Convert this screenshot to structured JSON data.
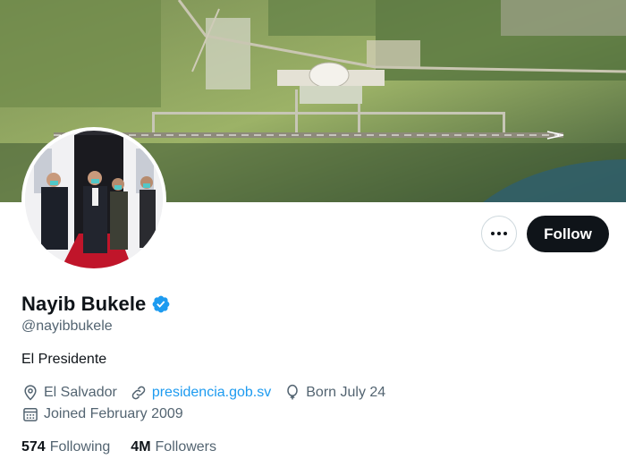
{
  "profile": {
    "name": "Nayib Bukele",
    "handle": "@nayibbukele",
    "bio": "El Presidente",
    "location": "El Salvador",
    "website": "presidencia.gob.sv",
    "birthday": "Born July 24",
    "joined": "Joined February 2009",
    "following_count": "574",
    "following_label": "Following",
    "followers_count": "4M",
    "followers_label": "Followers"
  },
  "actions": {
    "follow_label": "Follow"
  },
  "icons": {
    "more": "more-dots-icon",
    "verified": "verified-badge-icon",
    "location": "location-pin-icon",
    "link": "link-icon",
    "birthday": "balloon-icon",
    "joined": "calendar-icon"
  },
  "colors": {
    "accent": "#1d9bf0",
    "text": "#0f1419",
    "muted": "#536471",
    "follow_bg": "#0f1419"
  }
}
